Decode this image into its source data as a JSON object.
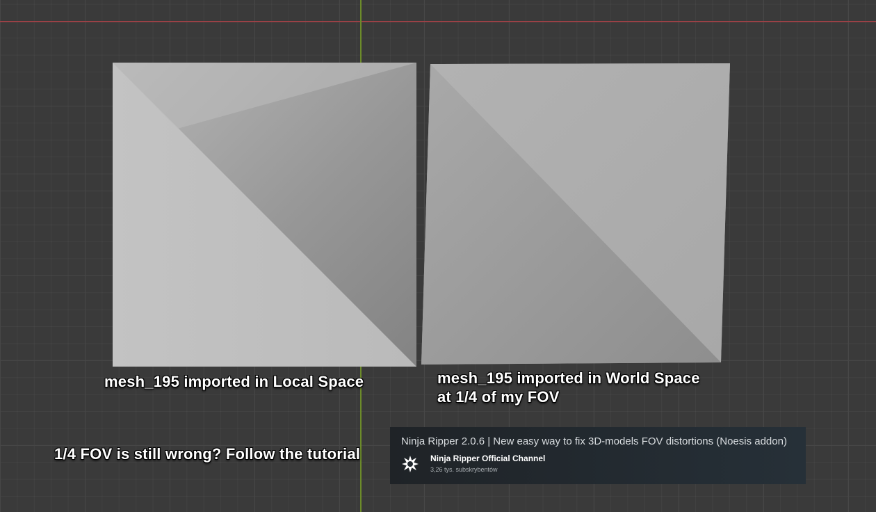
{
  "viewport": {
    "x_axis_color": "#9a4146",
    "y_axis_color": "#6c8b2a"
  },
  "meshes": [
    {
      "name": "mesh_195",
      "caption": "mesh_195 imported in Local Space"
    },
    {
      "name": "mesh_195",
      "caption_line1": "mesh_195 imported in World Space",
      "caption_line2": "at 1/4 of my FOV"
    }
  ],
  "tutorial_prompt": "1/4 FOV is still wrong? Follow the tutorial",
  "video_card": {
    "title": "Ninja Ripper 2.0.6 | New easy way to fix 3D-models FOV distortions (Noesis addon)",
    "channel_name": "Ninja Ripper Official Channel",
    "subscribers": "3,26 tys. subskrybentów",
    "channel_icon": "shuriken-icon"
  }
}
